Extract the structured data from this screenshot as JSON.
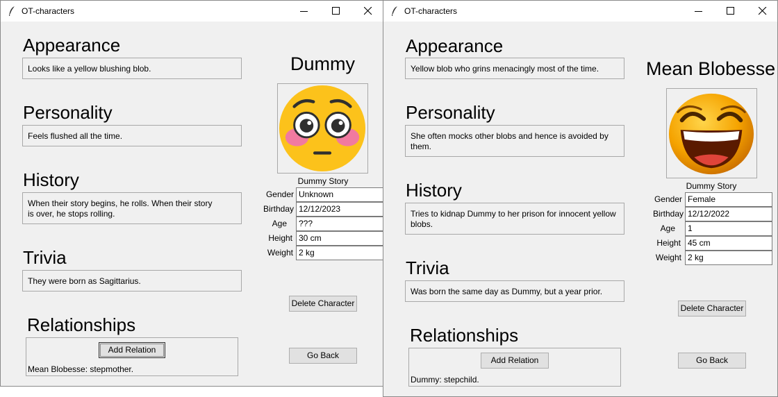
{
  "windows": [
    {
      "title": "OT-characters",
      "headings": {
        "appearance": "Appearance",
        "personality": "Personality",
        "history": "History",
        "trivia": "Trivia",
        "relationships": "Relationships"
      },
      "appearance_text": [
        "Looks like a yellow blushing blob."
      ],
      "personality_text": [
        "Feels flushed all the time."
      ],
      "history_text": [
        "When their story begins, he rolls. When their story",
        "is over, he stops rolling."
      ],
      "trivia_text": [
        "They were born as Sagittarius."
      ],
      "name": "Dummy",
      "picture_icon": "flushed-face-emoji",
      "story": "Dummy Story",
      "fields": [
        {
          "label": "Gender",
          "value": "Unknown"
        },
        {
          "label": "Birthday",
          "value": "12/12/2023"
        },
        {
          "label": "Age",
          "value": "???"
        },
        {
          "label": "Height",
          "value": "30 cm"
        },
        {
          "label": "Weight",
          "value": "2 kg"
        }
      ],
      "delete_label": "Delete Character",
      "back_label": "Go Back",
      "add_relation_label": "Add Relation",
      "relations": [
        "Mean Blobesse: stepmother."
      ]
    },
    {
      "title": "OT-characters",
      "headings": {
        "appearance": "Appearance",
        "personality": "Personality",
        "history": "History",
        "trivia": "Trivia",
        "relationships": "Relationships"
      },
      "appearance_text": [
        "Yellow blob who grins menacingly most of the time."
      ],
      "personality_text": [
        "She often mocks other blobs and hence is avoided by",
        "them."
      ],
      "history_text": [
        "Tries to kidnap Dummy to her prison for innocent yellow",
        "blobs."
      ],
      "trivia_text": [
        "Was born the same day as Dummy, but a year prior."
      ],
      "name": "Mean Blobesse",
      "picture_icon": "laughing-face-emoji",
      "story": "Dummy Story",
      "fields": [
        {
          "label": "Gender",
          "value": "Female"
        },
        {
          "label": "Birthday",
          "value": "12/12/2022"
        },
        {
          "label": "Age",
          "value": "1"
        },
        {
          "label": "Height",
          "value": "45 cm"
        },
        {
          "label": "Weight",
          "value": "2 kg"
        }
      ],
      "delete_label": "Delete Character",
      "back_label": "Go Back",
      "add_relation_label": "Add Relation",
      "relations": [
        "Dummy: stepchild."
      ]
    }
  ]
}
